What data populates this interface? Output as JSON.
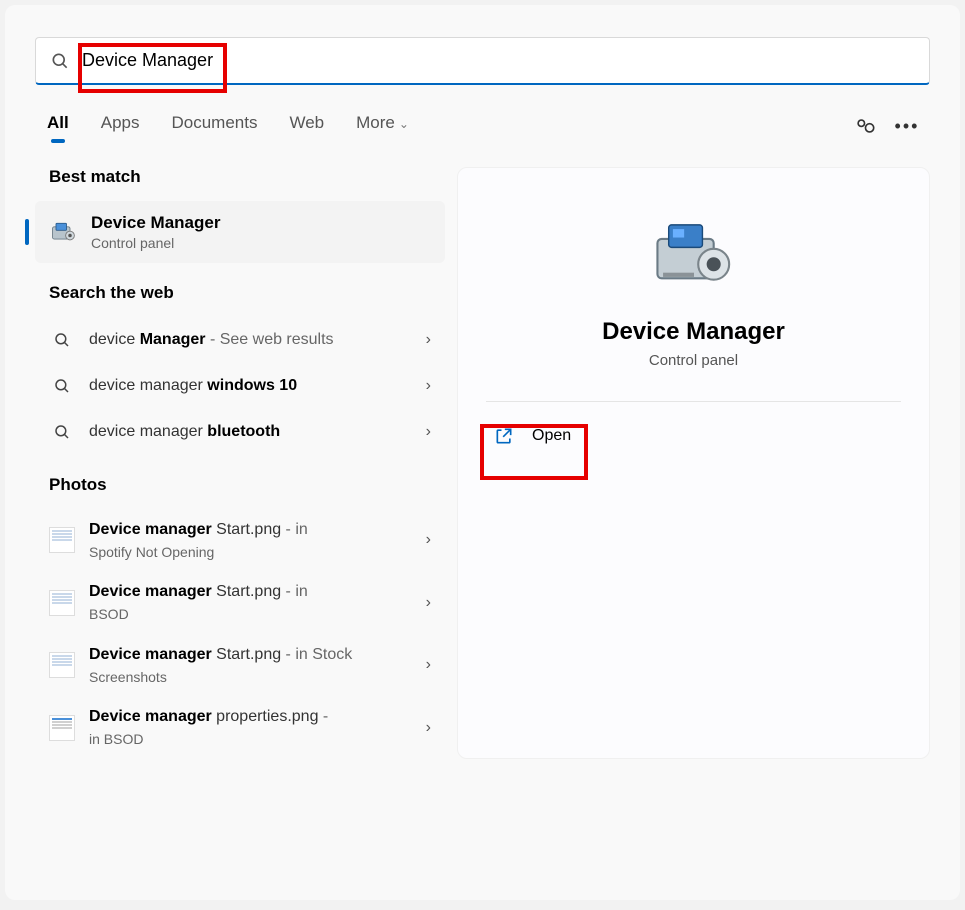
{
  "search": {
    "value": "Device Manager"
  },
  "tabs": {
    "all": "All",
    "apps": "Apps",
    "documents": "Documents",
    "web": "Web",
    "more": "More"
  },
  "headings": {
    "best_match": "Best match",
    "search_web": "Search the web",
    "photos": "Photos"
  },
  "best_match": {
    "title": "Device Manager",
    "subtitle": "Control panel"
  },
  "web_results": [
    {
      "pre": "device ",
      "bold": "Manager",
      "suffix": " - See web results"
    },
    {
      "pre": "device manager ",
      "bold": "windows 10",
      "suffix": ""
    },
    {
      "pre": "device manager ",
      "bold": "bluetooth",
      "suffix": ""
    }
  ],
  "photos": [
    {
      "bold": "Device manager",
      "mid": " Start.png",
      "suffix": " - in ",
      "sub": "Spotify Not Opening"
    },
    {
      "bold": "Device manager",
      "mid": " Start.png",
      "suffix": " - in ",
      "sub": "BSOD"
    },
    {
      "bold": "Device manager",
      "mid": " Start.png",
      "suffix": " - in Stock ",
      "sub": "Screenshots"
    },
    {
      "bold": "Device manager",
      "mid": " properties.png",
      "suffix": " - ",
      "sub": "in BSOD"
    }
  ],
  "detail": {
    "title": "Device Manager",
    "subtitle": "Control panel",
    "open": "Open"
  }
}
